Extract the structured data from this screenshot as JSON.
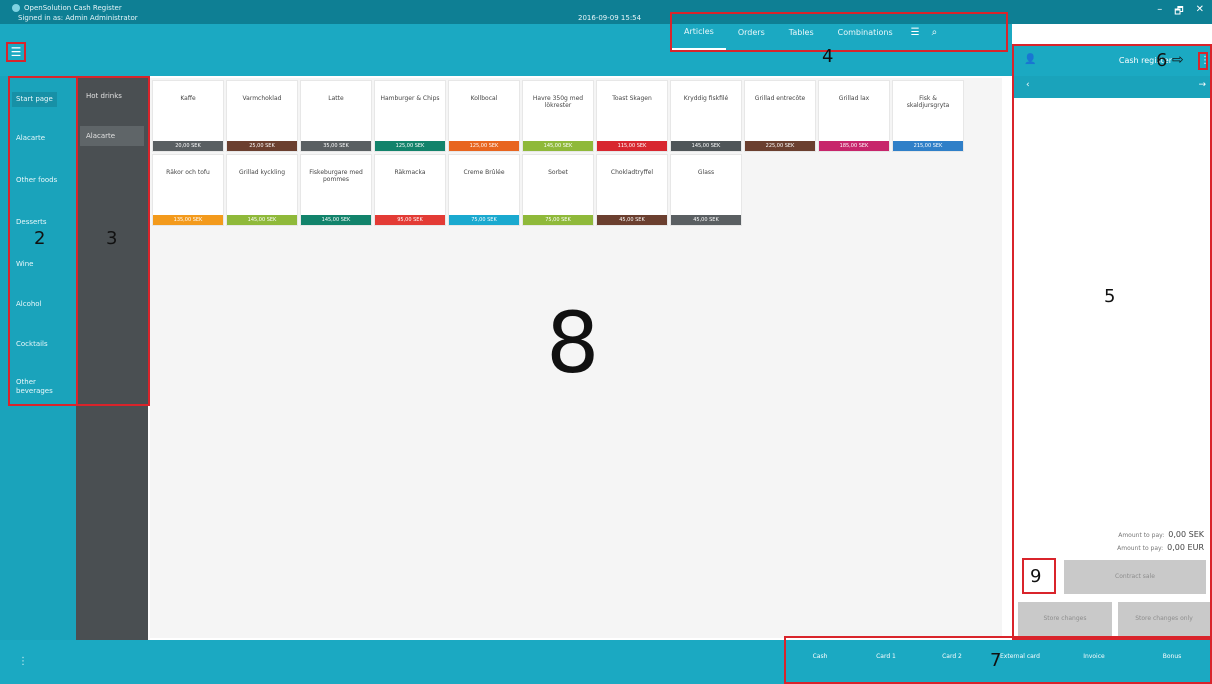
{
  "window": {
    "app_name": "OpenSolution Cash Register",
    "signed_in": "Signed in as: Admin Administrator",
    "date": "2016-09-09 15:54",
    "controls": [
      "–",
      "🗗",
      "✕"
    ]
  },
  "toolbar": {
    "menu_icon": "menu-icon",
    "tabs": [
      "Articles",
      "Orders",
      "Tables",
      "Combinations"
    ],
    "active_tab": "Articles"
  },
  "left_nav": {
    "items": [
      "Start page",
      "Alacarte",
      "Other foods",
      "Desserts",
      "Wine",
      "Alcohol",
      "Cocktails",
      "Other beverages"
    ],
    "active": "Start page"
  },
  "sub_nav": {
    "items": [
      "Hot drinks",
      "Alacarte"
    ],
    "active": "Alacarte"
  },
  "articles": [
    {
      "name": "Kaffe",
      "price": "20,00 SEK",
      "color": "#5a5f62"
    },
    {
      "name": "Varmchoklad",
      "price": "25,00 SEK",
      "color": "#6b3f2f"
    },
    {
      "name": "Latte",
      "price": "35,00 SEK",
      "color": "#5a5f62"
    },
    {
      "name": "Hamburger & Chips",
      "price": "125,00 SEK",
      "color": "#12836b"
    },
    {
      "name": "Kollbocal",
      "price": "125,00 SEK",
      "color": "#e8651f"
    },
    {
      "name": "Havre 350g med lökrester",
      "price": "145,00 SEK",
      "color": "#8fb93a"
    },
    {
      "name": "Toast Skagen",
      "price": "115,00 SEK",
      "color": "#d8262f"
    },
    {
      "name": "Kryddig fiskfilé",
      "price": "145,00 SEK",
      "color": "#4f5558"
    },
    {
      "name": "Grillad entrecôte",
      "price": "225,00 SEK",
      "color": "#6b3f2f"
    },
    {
      "name": "Grillad lax",
      "price": "185,00 SEK",
      "color": "#c7256b"
    },
    {
      "name": "Fisk & skaldjursgryta",
      "price": "215,00 SEK",
      "color": "#2f7fc8"
    },
    {
      "name": "Räkor och tofu",
      "price": "135,00 SEK",
      "color": "#f39a1c"
    },
    {
      "name": "Grillad kyckling",
      "price": "145,00 SEK",
      "color": "#8fb93a"
    },
    {
      "name": "Fiskeburgare med pommes",
      "price": "145,00 SEK",
      "color": "#12836b"
    },
    {
      "name": "Räkmacka",
      "price": "95,00 SEK",
      "color": "#e33b35"
    },
    {
      "name": "Creme Brûlée",
      "price": "75,00 SEK",
      "color": "#1aa9cf"
    },
    {
      "name": "Sorbet",
      "price": "75,00 SEK",
      "color": "#8fb93a"
    },
    {
      "name": "Chokladtryffel",
      "price": "45,00 SEK",
      "color": "#6b3f2f"
    },
    {
      "name": "Glass",
      "price": "45,00 SEK",
      "color": "#5a5f62"
    }
  ],
  "right_panel": {
    "title": "Cash register",
    "amount_lines": [
      {
        "label": "Amount to pay:",
        "value": "0,00 SEK"
      },
      {
        "label": "Amount to pay:",
        "value": "0,00 EUR"
      }
    ],
    "buttons": {
      "contract": "Contract sale",
      "store_changes": "Store changes",
      "store_changes_only": "Store changes only"
    }
  },
  "payment": {
    "buttons": [
      "Cash",
      "Card 1",
      "Card 2",
      "External card",
      "Invoice",
      "Bonus"
    ]
  },
  "markers": [
    "2",
    "3",
    "4",
    "5",
    "6",
    "7",
    "8",
    "9"
  ],
  "colors": {
    "primary": "#1ba9c2",
    "title": "#0e7f94",
    "subnav": "#4a4f52",
    "highlight": "#d9242b"
  }
}
